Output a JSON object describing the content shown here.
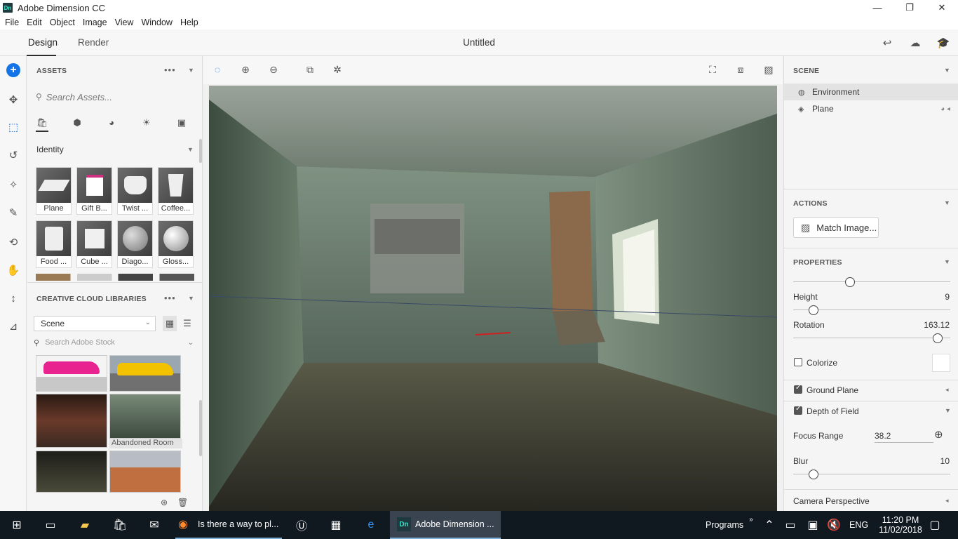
{
  "window": {
    "title": "Adobe Dimension CC",
    "logo": "Dn"
  },
  "menu": [
    "File",
    "Edit",
    "Object",
    "Image",
    "View",
    "Window",
    "Help"
  ],
  "tabs": {
    "design": "Design",
    "render": "Render"
  },
  "document_title": "Untitled",
  "assets": {
    "header": "ASSETS",
    "search_placeholder": "Search Assets...",
    "category": "Identity",
    "items": [
      "Plane",
      "Gift B...",
      "Twist ...",
      "Coffee...",
      "Food ...",
      "Cube ...",
      "Diago...",
      "Gloss..."
    ]
  },
  "cc_libraries": {
    "header": "CREATIVE CLOUD LIBRARIES",
    "library": "Scene",
    "stock_placeholder": "Search Adobe Stock",
    "selected_label": "Abandoned Room"
  },
  "scene": {
    "header": "SCENE",
    "items": [
      "Environment",
      "Plane"
    ]
  },
  "actions": {
    "header": "ACTIONS",
    "match_image": "Match Image..."
  },
  "properties": {
    "header": "PROPERTIES",
    "height_label": "Height",
    "height_value": "9",
    "rotation_label": "Rotation",
    "rotation_value": "163.12",
    "colorize_label": "Colorize",
    "ground_plane_label": "Ground Plane",
    "dof_label": "Depth of Field",
    "focus_range_label": "Focus Range",
    "focus_range_value": "38.2",
    "blur_label": "Blur",
    "blur_value": "10",
    "camera_perspective_label": "Camera Perspective"
  },
  "taskbar": {
    "firefox_title": "Is there a way to pl...",
    "dimension_title": "Adobe Dimension ...",
    "programs": "Programs",
    "language": "ENG",
    "time": "11:20 PM",
    "date": "11/02/2018"
  },
  "colors": {
    "accent": "#1473e6",
    "taskbar": "#101820"
  }
}
